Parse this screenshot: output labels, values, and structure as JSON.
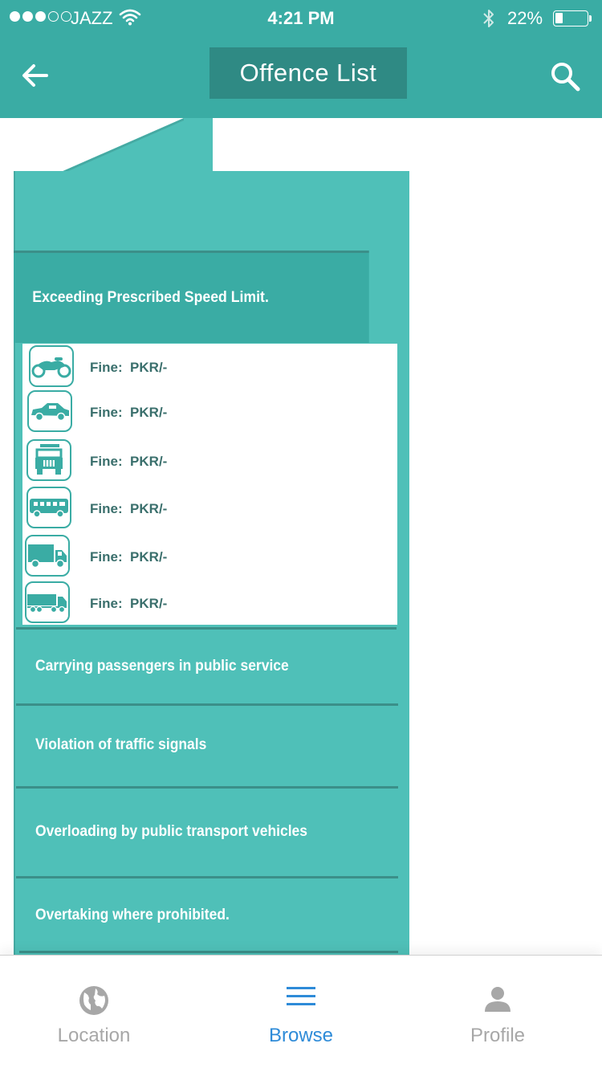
{
  "status_bar": {
    "carrier": "JAZZ",
    "time": "4:21 PM",
    "battery": "22%",
    "signal_bars_filled": 3,
    "signal_bars_total": 5
  },
  "nav": {
    "title": "Offence List",
    "back_icon": "arrow-left-icon",
    "search_icon": "search-icon"
  },
  "expanded_offence": {
    "title": "Exceeding Prescribed Speed Limit.",
    "fines": [
      {
        "vehicle": "motorcycle-icon",
        "text": "Fine:  PKR/-"
      },
      {
        "vehicle": "car-icon",
        "text": "Fine:  PKR/-"
      },
      {
        "vehicle": "jeep-icon",
        "text": "Fine:  PKR/-"
      },
      {
        "vehicle": "bus-icon",
        "text": "Fine:  PKR/-"
      },
      {
        "vehicle": "truck-icon",
        "text": "Fine:  PKR/-"
      },
      {
        "vehicle": "trailer-icon",
        "text": "Fine:  PKR/-"
      }
    ]
  },
  "offences": [
    {
      "title": "Carrying passengers in public service"
    },
    {
      "title": "Violation of traffic signals"
    },
    {
      "title": "Overloading by public transport vehicles"
    },
    {
      "title": "Overtaking where prohibited."
    }
  ],
  "tabs": [
    {
      "label": "Location",
      "icon": "globe-icon",
      "active": false
    },
    {
      "label": "Browse",
      "icon": "list-icon",
      "active": true
    },
    {
      "label": "Profile",
      "icon": "person-icon",
      "active": false
    }
  ],
  "colors": {
    "primary": "#3aaca4",
    "panel": "#4fc0b8",
    "title_bg": "#2f8a84",
    "active_tab": "#2e8bd8",
    "inactive_tab": "#a7a7a7"
  }
}
